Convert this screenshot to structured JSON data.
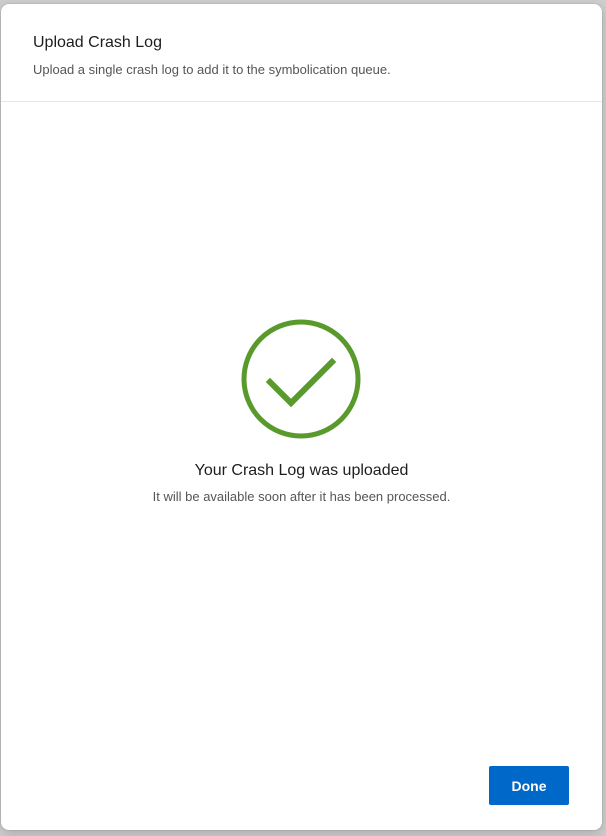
{
  "dialog": {
    "title": "Upload Crash Log",
    "subtitle": "Upload a single crash log to add it to the symbolication queue."
  },
  "status": {
    "icon": "check-circle-icon",
    "icon_color": "#5a9a2c",
    "title": "Your Crash Log was uploaded",
    "description": "It will be available soon after it has been processed."
  },
  "actions": {
    "done_label": "Done",
    "done_color": "#0068c9"
  }
}
